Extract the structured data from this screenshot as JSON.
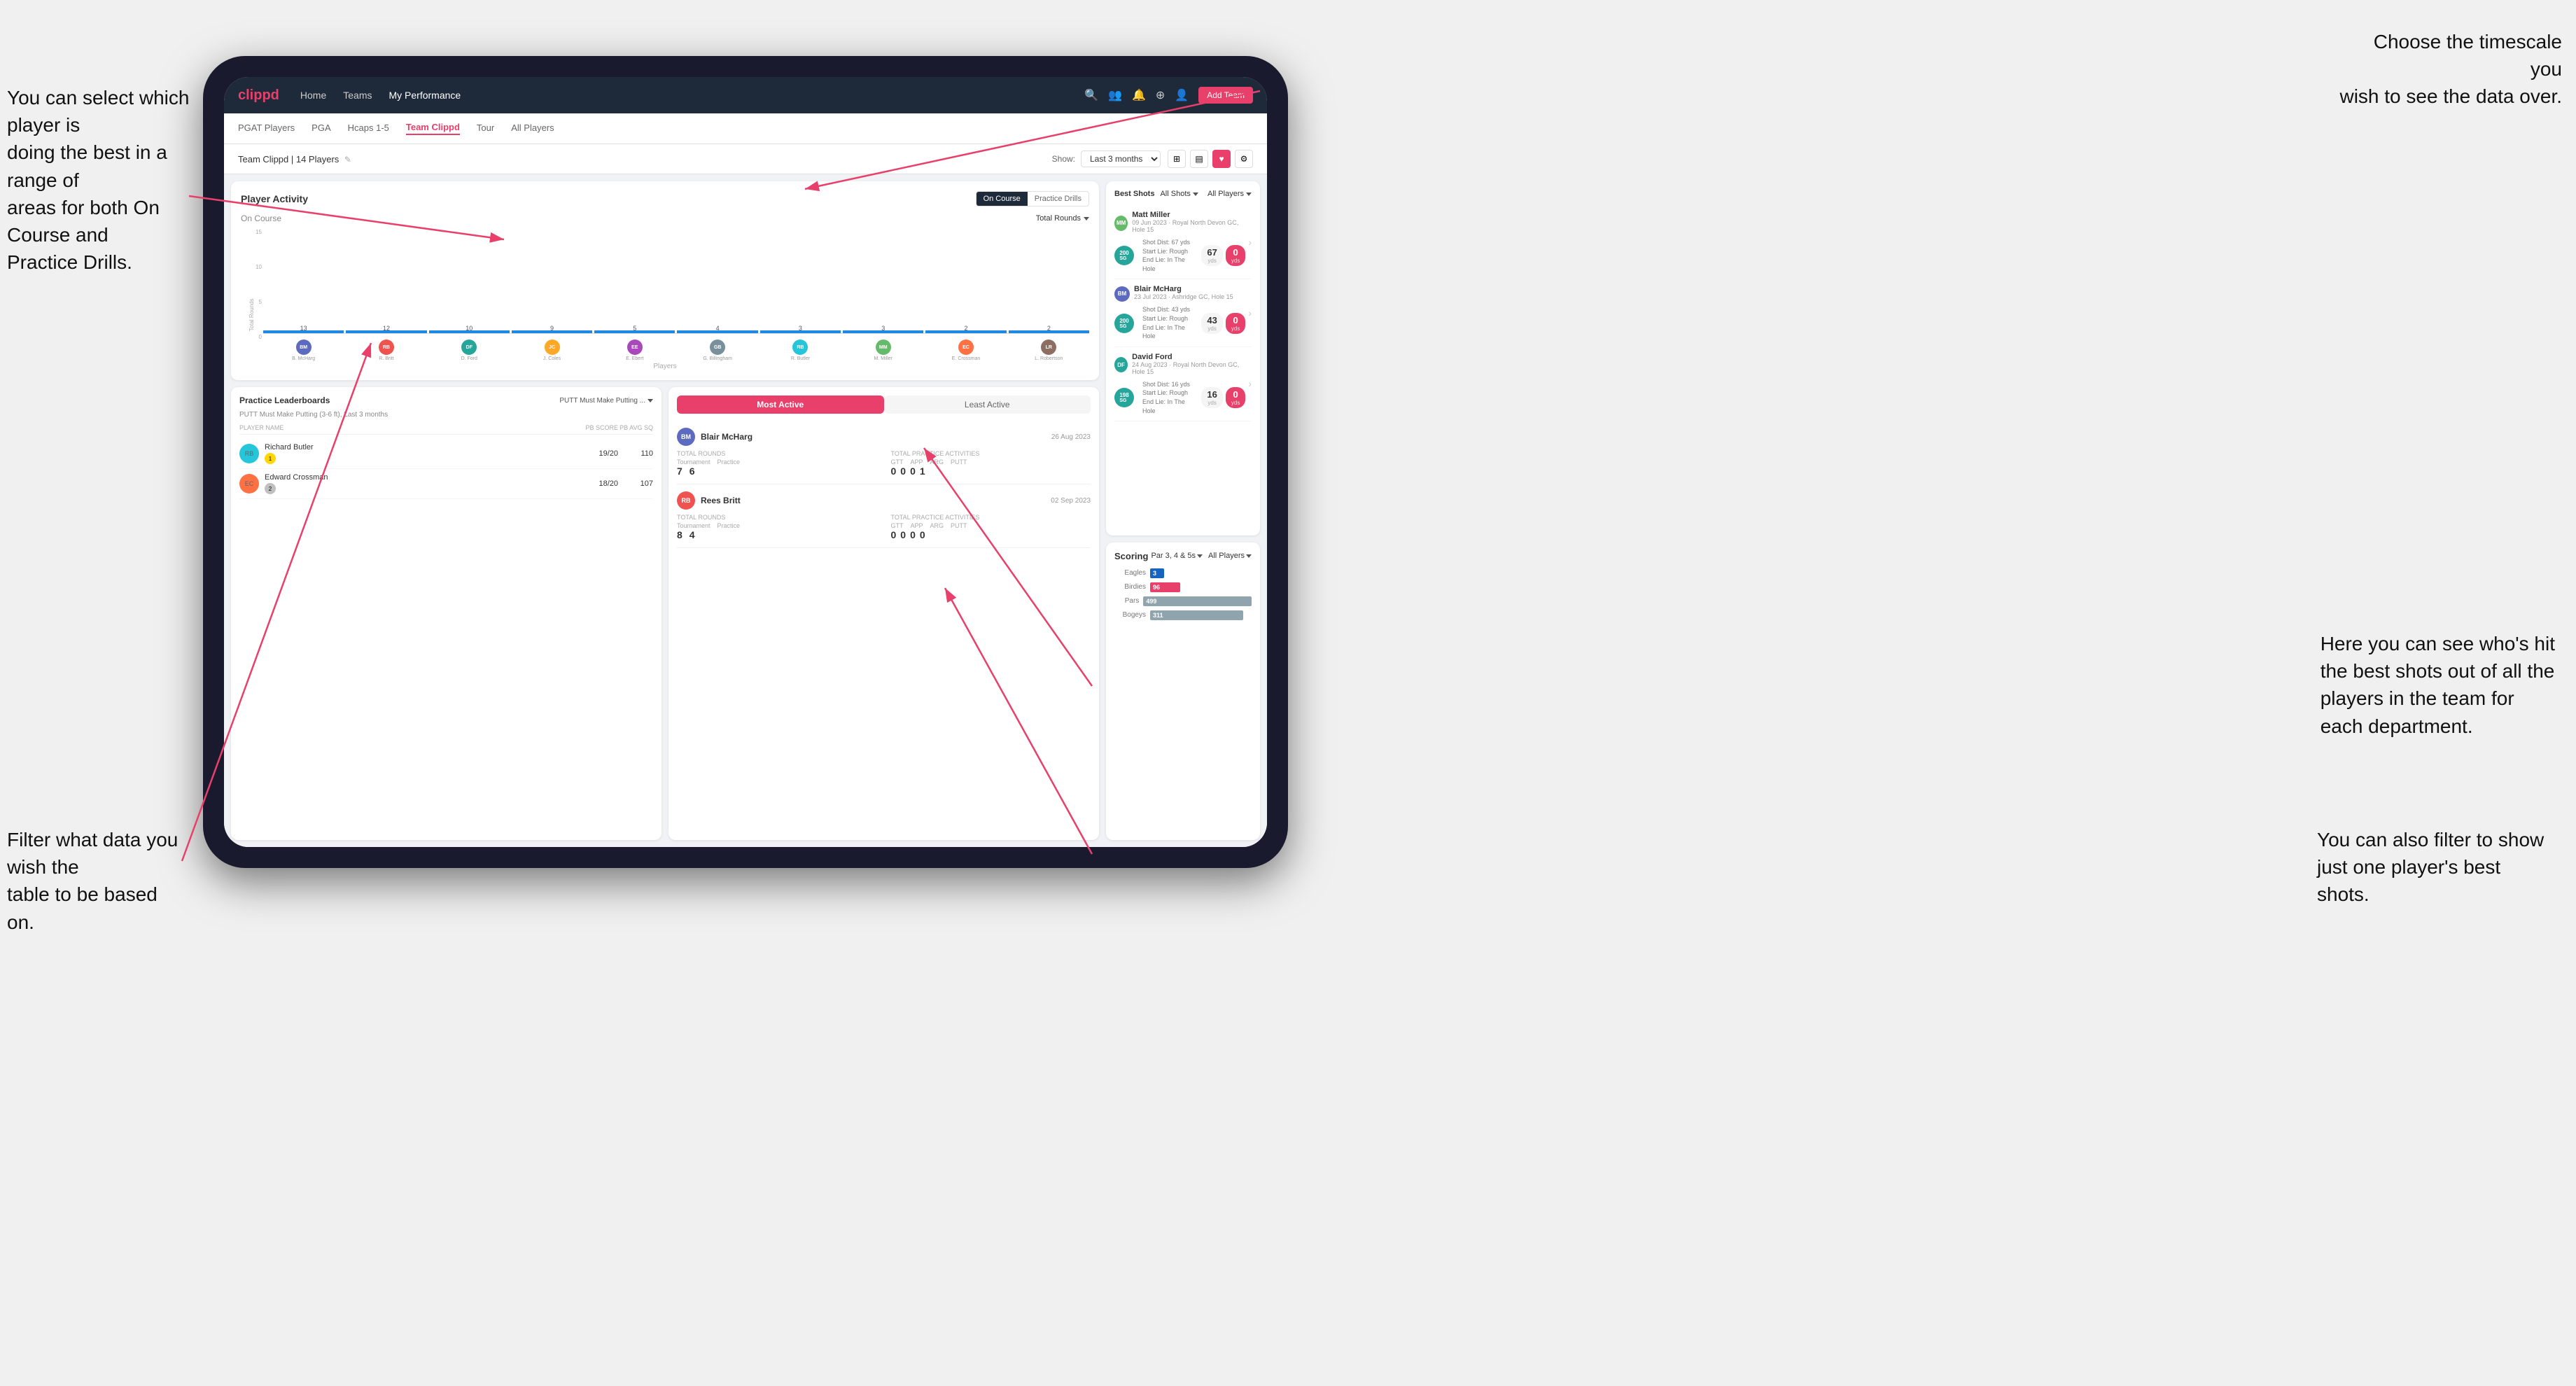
{
  "annotations": {
    "a1": "You can select which player is\ndoing the best in a range of\nareas for both On Course and\nPractice Drills.",
    "a2": "Choose the timescale you\nwish to see the data over.",
    "a3": "Filter what data you wish the\ntable to be based on.",
    "a4": "Here you can see who's hit\nthe best shots out of all the\nplayers in the team for\neach department.",
    "a5": "You can also filter to show\njust one player's best shots."
  },
  "nav": {
    "logo": "clippd",
    "links": [
      "Home",
      "Teams",
      "My Performance"
    ],
    "icons": [
      "search",
      "people",
      "bell",
      "add",
      "profile"
    ]
  },
  "sub_nav": {
    "tabs": [
      "PGAT Players",
      "PGA",
      "Hcaps 1-5",
      "Team Clippd",
      "Tour",
      "All Players"
    ],
    "active": "Team Clippd"
  },
  "team_header": {
    "name": "Team Clippd | 14 Players",
    "show_label": "Show:",
    "timeframe": "Last 3 months",
    "add_btn": "Add Team"
  },
  "player_activity": {
    "title": "Player Activity",
    "toggle": [
      "On Course",
      "Practice Drills"
    ],
    "active_toggle": "On Course",
    "section_title": "On Course",
    "chart_filter": "Total Rounds",
    "y_labels": [
      "15",
      "10",
      "5",
      "0"
    ],
    "y_axis_title": "Total Rounds",
    "x_axis_title": "Players",
    "bars": [
      {
        "name": "B. McHarg",
        "value": 13,
        "color": "#b0bec5",
        "initials": "BM",
        "bg": "#5c6bc0"
      },
      {
        "name": "R. Britt",
        "value": 12,
        "color": "#b0bec5",
        "initials": "RB",
        "bg": "#ef5350"
      },
      {
        "name": "D. Ford",
        "value": 10,
        "color": "#b0bec5",
        "initials": "DF",
        "bg": "#26a69a"
      },
      {
        "name": "J. Coles",
        "value": 9,
        "color": "#b0bec5",
        "initials": "JC",
        "bg": "#ffa726"
      },
      {
        "name": "E. Ebert",
        "value": 5,
        "color": "#b0bec5",
        "initials": "EE",
        "bg": "#ab47bc"
      },
      {
        "name": "G. Billingham",
        "value": 4,
        "color": "#b0bec5",
        "initials": "GB",
        "bg": "#78909c"
      },
      {
        "name": "R. Butler",
        "value": 3,
        "color": "#b0bec5",
        "initials": "RB2",
        "bg": "#26c6da"
      },
      {
        "name": "M. Miller",
        "value": 3,
        "color": "#b0bec5",
        "initials": "MM",
        "bg": "#66bb6a"
      },
      {
        "name": "E. Crossman",
        "value": 2,
        "color": "#b0bec5",
        "initials": "EC",
        "bg": "#ff7043"
      },
      {
        "name": "L. Robertson",
        "value": 2,
        "color": "#b0bec5",
        "initials": "LR",
        "bg": "#8d6e63"
      }
    ]
  },
  "practice_leaderboards": {
    "title": "Practice Leaderboards",
    "filter": "PUTT Must Make Putting ...",
    "sub": "PUTT Must Make Putting (3-6 ft), Last 3 months",
    "columns": [
      "PLAYER NAME",
      "PB SCORE",
      "PB AVG SQ"
    ],
    "rows": [
      {
        "name": "Richard Butler",
        "pb_score": "19/20",
        "pb_avg": "110",
        "rank": "1",
        "rank_color": "#ffd700",
        "initials": "RB",
        "bg": "#26c6da"
      },
      {
        "name": "Edward Crossman",
        "pb_score": "18/20",
        "pb_avg": "107",
        "rank": "2",
        "rank_color": "#c0c0c0",
        "initials": "EC",
        "bg": "#ff7043"
      }
    ]
  },
  "most_active": {
    "tabs": [
      "Most Active",
      "Least Active"
    ],
    "active": "Most Active",
    "players": [
      {
        "name": "Blair McHarg",
        "date": "26 Aug 2023",
        "total_rounds_label": "Total Rounds",
        "rounds_tournament": "7",
        "rounds_practice": "6",
        "practice_label": "Total Practice Activities",
        "gtt": "0",
        "app": "0",
        "arg": "0",
        "putt": "1",
        "initials": "BM",
        "bg": "#5c6bc0"
      },
      {
        "name": "Rees Britt",
        "date": "02 Sep 2023",
        "total_rounds_label": "Total Rounds",
        "rounds_tournament": "8",
        "rounds_practice": "4",
        "practice_label": "Total Practice Activities",
        "gtt": "0",
        "app": "0",
        "arg": "0",
        "putt": "0",
        "initials": "RB",
        "bg": "#ef5350"
      }
    ]
  },
  "best_shots": {
    "title_best": "Best Shots",
    "title_all": "All Shots",
    "all_players": "All Players",
    "players": [
      {
        "name": "Matt Miller",
        "date": "09 Jun 2023",
        "course": "Royal North Devon GC",
        "hole": "Hole 15",
        "badge": "200",
        "badge_sub": "SG",
        "badge_color": "#26a69a",
        "shot_dist": "Shot Dist: 67 yds",
        "start_lie": "Start Lie: Rough",
        "end_lie": "End Lie: In The Hole",
        "metric1": "67",
        "metric1_unit": "yds",
        "metric2": "0",
        "metric2_unit": "yds",
        "initials": "MM",
        "bg": "#66bb6a"
      },
      {
        "name": "Blair McHarg",
        "date": "23 Jul 2023",
        "course": "Ashridge GC",
        "hole": "Hole 15",
        "badge": "200",
        "badge_sub": "SG",
        "badge_color": "#26a69a",
        "shot_dist": "Shot Dist: 43 yds",
        "start_lie": "Start Lie: Rough",
        "end_lie": "End Lie: In The Hole",
        "metric1": "43",
        "metric1_unit": "yds",
        "metric2": "0",
        "metric2_unit": "yds",
        "initials": "BM",
        "bg": "#5c6bc0"
      },
      {
        "name": "David Ford",
        "date": "24 Aug 2023",
        "course": "Royal North Devon GC",
        "hole": "Hole 15",
        "badge": "198",
        "badge_sub": "SG",
        "badge_color": "#26a69a",
        "shot_dist": "Shot Dist: 16 yds",
        "start_lie": "Start Lie: Rough",
        "end_lie": "End Lie: In The Hole",
        "metric1": "16",
        "metric1_unit": "yds",
        "metric2": "0",
        "metric2_unit": "yds",
        "initials": "DF",
        "bg": "#26a69a"
      }
    ]
  },
  "scoring": {
    "title": "Scoring",
    "filter1": "Par 3, 4 & 5s",
    "filter2": "All Players",
    "bars": [
      {
        "label": "Eagles",
        "value": 3,
        "max": 499,
        "color": "#1565c0",
        "text": "3"
      },
      {
        "label": "Birdies",
        "value": 96,
        "max": 499,
        "color": "#e8406a",
        "text": "96"
      },
      {
        "label": "Pars",
        "value": 499,
        "max": 499,
        "color": "#78909c",
        "text": "499"
      },
      {
        "label": "Bogeys",
        "value": 311,
        "max": 499,
        "color": "#78909c",
        "text": "311"
      }
    ]
  },
  "colors": {
    "accent": "#e8406a",
    "nav_bg": "#1e2a3a",
    "card_bg": "#ffffff"
  }
}
